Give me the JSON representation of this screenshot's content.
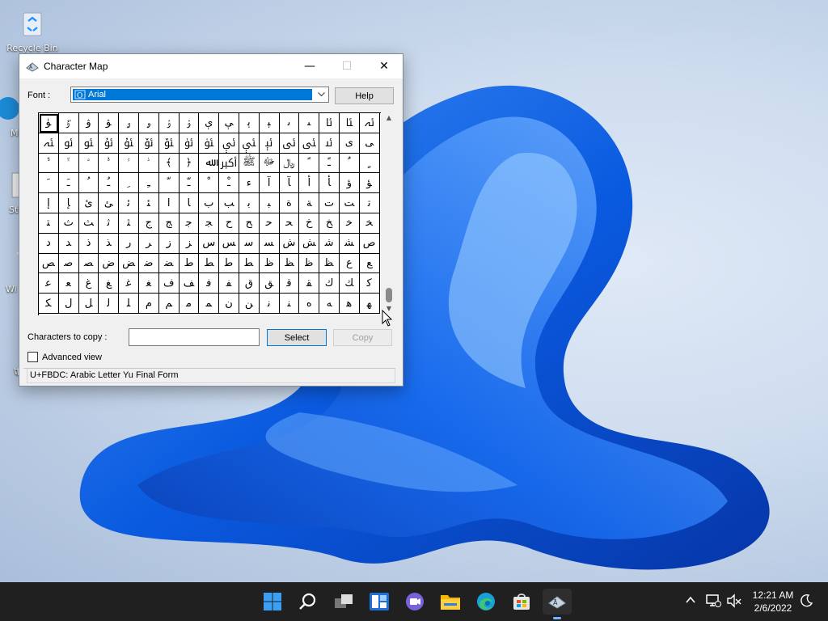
{
  "desktop": {
    "icons": [
      {
        "label": "Recycle Bin",
        "icon": "recycle-bin-icon"
      },
      {
        "label": "Mi",
        "icon": "edge-shortcut-icon"
      },
      {
        "label": "Sti",
        "icon": "app-shortcut-icon"
      },
      {
        "label": "Wi",
        "icon": "pen-shortcut-icon"
      },
      {
        "label": "W",
        "icon": "app-shortcut-icon"
      },
      {
        "label": "T",
        "icon": "app-shortcut-icon"
      }
    ]
  },
  "window": {
    "title": "Character Map",
    "font_label": "Font :",
    "font_value": "Arial",
    "help_label": "Help",
    "chars_to_copy_label": "Characters to copy :",
    "chars_to_copy_value": "",
    "select_label": "Select",
    "copy_label": "Copy",
    "advanced_view_label": "Advanced view",
    "advanced_view_checked": false,
    "status": "U+FBDC: Arabic Letter Yu Final Form"
  },
  "grid": {
    "rows": [
      [
        "ﯜ",
        "ﯝ",
        "ﯞ",
        "ﯟ",
        "ﯠ",
        "ﯡ",
        "ﯢ",
        "ﯣ",
        "ﯤ",
        "ﯥ",
        "ﯦ",
        "ﯧ",
        "ﯨ",
        "ﯩ",
        "ﯪ",
        "ﯫ",
        "ﯬ"
      ],
      [
        "ﯭ",
        "ﯮ",
        "ﯯ",
        "ﯰ",
        "ﯱ",
        "ﯲ",
        "ﯳ",
        "ﯴ",
        "ﯵ",
        "ﯶ",
        "ﯷ",
        "ﯸ",
        "ﯹ",
        "ﯺ",
        "ﯻ",
        "ﯼ",
        "ﯽ"
      ],
      [
        "ﱞ",
        "ﱟ",
        "ﱠ",
        "ﱡ",
        "ﱢ",
        "ﱣ",
        "﴾",
        "﴿",
        "ﷲ",
        "ﷳ",
        "ﷺ",
        "ﷻ",
        "﷼",
        "ﹰ",
        "ﹱ",
        "ﹲ",
        "ﹴ"
      ],
      [
        "ﹶ",
        "ﹷ",
        "ﹸ",
        "ﹹ",
        "ﹺ",
        "ﹻ",
        "ﹼ",
        "ﹽ",
        "ﹾ",
        "ﹿ",
        "ﺀ",
        "ﺁ",
        "ﺂ",
        "ﺃ",
        "ﺄ",
        "ﺅ",
        "ﺆ"
      ],
      [
        "ﺇ",
        "ﺈ",
        "ﺉ",
        "ﺊ",
        "ﺋ",
        "ﺌ",
        "ﺍ",
        "ﺎ",
        "ﺏ",
        "ﺐ",
        "ﺑ",
        "ﺒ",
        "ﺓ",
        "ﺔ",
        "ﺕ",
        "ﺖ",
        "ﺗ"
      ],
      [
        "ﺘ",
        "ﺙ",
        "ﺚ",
        "ﺛ",
        "ﺜ",
        "ﺝ",
        "ﺞ",
        "ﺟ",
        "ﺠ",
        "ﺡ",
        "ﺢ",
        "ﺣ",
        "ﺤ",
        "ﺥ",
        "ﺦ",
        "ﺧ",
        "ﺨ"
      ],
      [
        "ﺩ",
        "ﺪ",
        "ﺫ",
        "ﺬ",
        "ﺭ",
        "ﺮ",
        "ﺯ",
        "ﺰ",
        "ﺱ",
        "ﺲ",
        "ﺳ",
        "ﺴ",
        "ﺵ",
        "ﺶ",
        "ﺷ",
        "ﺸ",
        "ﺹ"
      ],
      [
        "ﺺ",
        "ﺻ",
        "ﺼ",
        "ﺽ",
        "ﺾ",
        "ﺿ",
        "ﻀ",
        "ﻁ",
        "ﻂ",
        "ﻃ",
        "ﻄ",
        "ﻅ",
        "ﻆ",
        "ﻇ",
        "ﻈ",
        "ﻉ",
        "ﻊ"
      ],
      [
        "ﻋ",
        "ﻌ",
        "ﻍ",
        "ﻎ",
        "ﻏ",
        "ﻐ",
        "ﻑ",
        "ﻒ",
        "ﻓ",
        "ﻔ",
        "ﻕ",
        "ﻖ",
        "ﻗ",
        "ﻘ",
        "ﻙ",
        "ﻚ",
        "ﻛ"
      ],
      [
        "ﻜ",
        "ﻝ",
        "ﻞ",
        "ﻟ",
        "ﻠ",
        "ﻡ",
        "ﻢ",
        "ﻣ",
        "ﻤ",
        "ﻥ",
        "ﻦ",
        "ﻧ",
        "ﻨ",
        "ﻩ",
        "ﻪ",
        "ﻫ",
        "ﻬ"
      ]
    ]
  },
  "taskbar": {
    "apps": [
      "windows-start-icon",
      "search-icon",
      "task-view-icon",
      "widgets-icon",
      "chat-icon",
      "file-explorer-icon",
      "edge-icon",
      "store-icon",
      "character-map-icon"
    ],
    "time": "12:21 AM",
    "date": "2/6/2022"
  }
}
